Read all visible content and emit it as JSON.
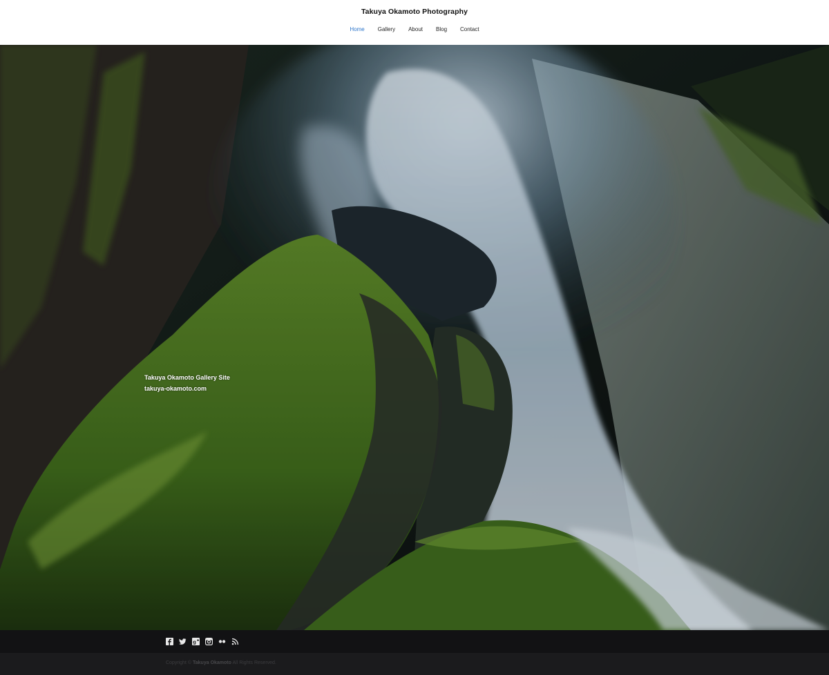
{
  "header": {
    "site_title": "Takuya Okamoto Photography",
    "nav": [
      {
        "label": "Home",
        "active": true
      },
      {
        "label": "Gallery",
        "active": false
      },
      {
        "label": "About",
        "active": false
      },
      {
        "label": "Blog",
        "active": false
      },
      {
        "label": "Contact",
        "active": false
      }
    ]
  },
  "hero": {
    "caption_line1": "Takuya Okamoto Gallery Site",
    "caption_line2": "takuya-okamoto.com"
  },
  "social": {
    "icons": [
      "facebook-icon",
      "twitter-icon",
      "google-plus-icon",
      "instagram-icon",
      "flickr-icon",
      "rss-icon"
    ]
  },
  "footer": {
    "copyright_prefix": "Copyright ©",
    "copyright_owner": "Takuya Okamoto",
    "copyright_suffix": "All Rights Reserved."
  },
  "colors": {
    "accent": "#2a73c9",
    "header_bg": "#ffffff",
    "social_bar_bg": "#121214",
    "footer_bg": "#1b1b1d"
  }
}
